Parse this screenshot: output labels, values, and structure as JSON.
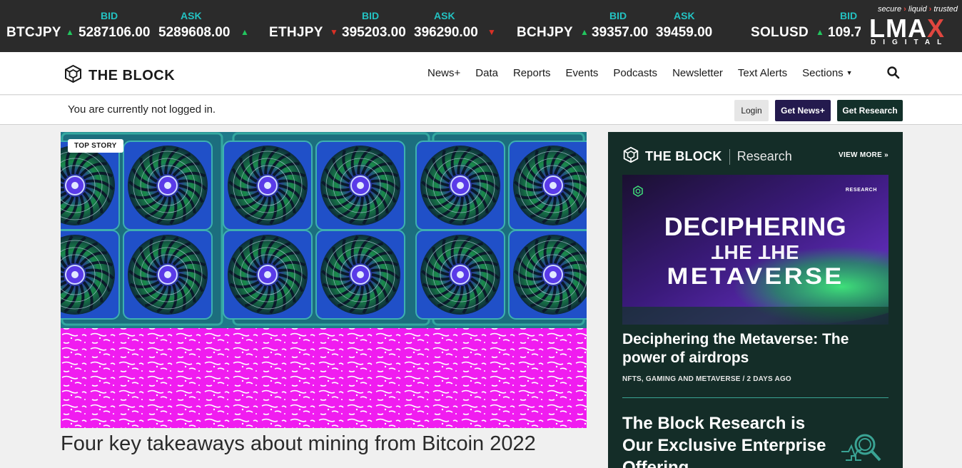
{
  "ticker": {
    "items": [
      {
        "symbol": "BTCJPY",
        "bid_label": "BID",
        "ask_label": "ASK",
        "bid": "5287106.00",
        "ask": "5289608.00",
        "bid_dir": "up",
        "ask_dir": "up"
      },
      {
        "symbol": "ETHJPY",
        "bid_label": "BID",
        "ask_label": "ASK",
        "bid": "395203.00",
        "ask": "396290.00",
        "bid_dir": "down",
        "ask_dir": "down"
      },
      {
        "symbol": "BCHJPY",
        "bid_label": "BID",
        "ask_label": "ASK",
        "bid": "39357.00",
        "ask": "39459.00",
        "bid_dir": "up",
        "ask_dir": "none"
      },
      {
        "symbol": "SOLUSD",
        "bid_label": "BID",
        "bid": "109.7",
        "bid_dir": "up"
      }
    ],
    "sponsor": {
      "tagline_1": "secure",
      "tagline_2": "liquid",
      "tagline_3": "trusted",
      "logo_a": "LMA",
      "logo_b": "X",
      "sub": "DIGITAL"
    }
  },
  "header": {
    "brand": "THE BLOCK",
    "nav": [
      "News+",
      "Data",
      "Reports",
      "Events",
      "Podcasts",
      "Newsletter",
      "Text Alerts",
      "Sections"
    ],
    "icons": {
      "logo": "cube-logo-icon",
      "search": "search-icon",
      "caret": "caret-down-icon"
    }
  },
  "login_bar": {
    "message": "You are currently not logged in.",
    "login": "Login",
    "get_news": "Get News+",
    "get_research": "Get Research"
  },
  "top_story": {
    "badge": "TOP STORY",
    "headline": "Four key takeaways about mining from Bitcoin 2022"
  },
  "research": {
    "brand": "THE BLOCK",
    "section": "Research",
    "view_more": "VIEW MORE »",
    "banner": {
      "label": "RESEARCH",
      "line1": "DECIPHERING",
      "line2": "THE THE",
      "line3": "METAVERSE"
    },
    "article_title": "Deciphering the Metaverse: The power of airdrops",
    "article_meta": "NFTS, GAMING AND METAVERSE / 2 DAYS AGO",
    "promo": "The Block Research is Our Exclusive Enterprise Offering",
    "colors": {
      "panel": "#142d28",
      "accent": "#3aa394"
    }
  }
}
